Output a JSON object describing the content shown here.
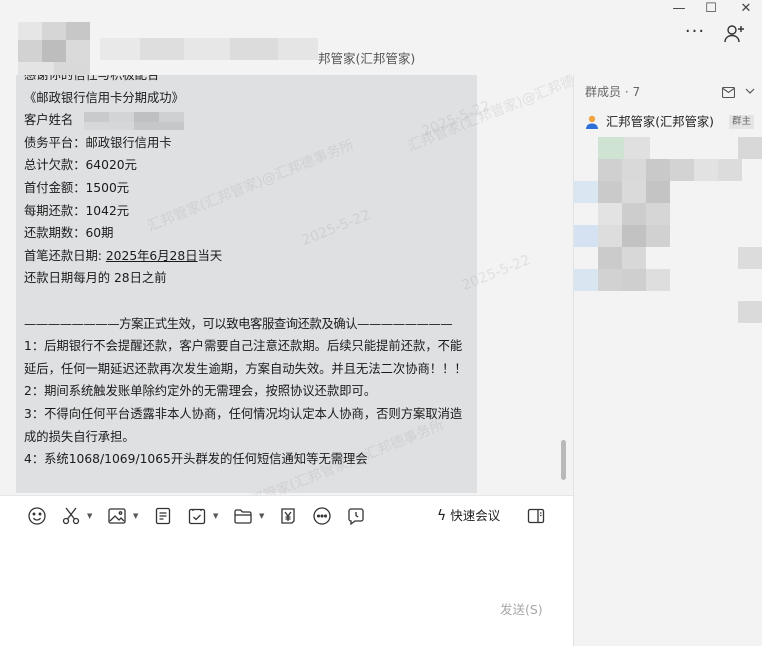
{
  "window": {
    "chat_title": "邦管家(汇邦管家)",
    "more_label": "···",
    "controls": {
      "minimize": "—",
      "maximize": "☐",
      "close": "✕"
    }
  },
  "message": {
    "lines": [
      "感谢你的信任与积极配合",
      "《邮政银行信用卡分期成功》",
      "客户姓名",
      "债务平台：邮政银行信用卡",
      "总计欠款：64020元",
      "首付金额：1500元",
      "每期还款：1042元",
      "还款期数：60期"
    ],
    "first_repay_label": "首笔还款日期: ",
    "first_repay_date": "2025年6月28日",
    "first_repay_suffix": "当天",
    "repay_day": "还款日期每月的 28日之前",
    "divider": "————————方案正式生效，可以致电客服查询还款及确认————————",
    "term1": "1：后期银行不会提醒还款，客户需要自己注意还款期。后续只能提前还款，不能延后，任何一期延迟还款再次发生逾期，方案自动失效。并且无法二次协商！！！",
    "term2": "2：期间系统触发账单除约定外的无需理会，按照协议还款即可。",
    "term3": "3：不得向任何平台透露非本人协商，任何情况均认定本人协商，否则方案取消造成的损失自行承担。",
    "term4": "4：系统1068/1069/1065开头群发的任何短信通知等无需理会"
  },
  "watermark": {
    "text": "汇邦管家(汇邦管家)@汇邦德事务所",
    "date": "2025-5-22"
  },
  "toolbar": {
    "icons": [
      "emoji-icon",
      "scissors-icon",
      "image-icon",
      "document-icon",
      "task-icon",
      "folder-icon",
      "yen-icon",
      "chat-bubble-icon",
      "clock-icon",
      "sidebar-icon"
    ],
    "meeting_label": "快速会议"
  },
  "composer": {
    "send_label": "发送(S)"
  },
  "members_panel": {
    "header": "群成员 · 7",
    "member_name": "汇邦管家(汇邦管家)",
    "owner_badge": "群主"
  },
  "colors": {
    "bubble": "#dfe0e2",
    "background": "#f3f3f3",
    "link_blue": "#1f5fbf"
  }
}
